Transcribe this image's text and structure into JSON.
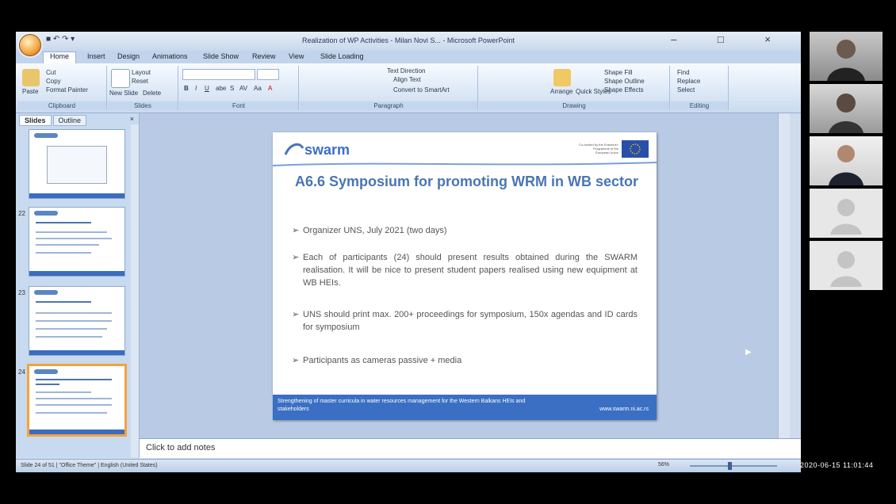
{
  "window": {
    "title": "Realization of WP Activities - Milan Novi S... - Microsoft PowerPoint",
    "quick_access": "■ ↶ ↷ ▾",
    "controls": "– □ ×"
  },
  "ribbon": {
    "tabs": [
      "Home",
      "Insert",
      "Design",
      "Animations",
      "Slide Show",
      "Review",
      "View",
      "Slide Loading"
    ],
    "active_tab": "Home",
    "groups": [
      {
        "label": "Clipboard",
        "buttons": [
          "Cut",
          "Copy",
          "Paste",
          "Format Painter"
        ]
      },
      {
        "label": "Slides",
        "buttons": [
          "Layout",
          "Reset",
          "New Slide",
          "Delete"
        ]
      },
      {
        "label": "Font",
        "buttons": [
          "B",
          "I",
          "U",
          "abe",
          "S",
          "AV",
          "Aa",
          "A"
        ]
      },
      {
        "label": "Paragraph",
        "buttons": [
          "Text Direction",
          "Align Text",
          "Convert to SmartArt"
        ]
      },
      {
        "label": "Drawing",
        "buttons": [
          "Arrange",
          "Quick Styles",
          "Shape Fill",
          "Shape Outline",
          "Shape Effects"
        ]
      },
      {
        "label": "Editing",
        "buttons": [
          "Find",
          "Replace",
          "Select"
        ]
      }
    ]
  },
  "slides_pane": {
    "tabs": [
      "Slides",
      "Outline"
    ],
    "close": "×",
    "thumbnails": [
      {
        "number": "",
        "title": "Certificate"
      },
      {
        "number": "22",
        "title": "A6.4 Training of trainers"
      },
      {
        "number": "23",
        "title": "A6.5 Dissemination"
      },
      {
        "number": "24",
        "title": "A6.6 Symposium for promoting WRM in WB sector"
      }
    ]
  },
  "slide": {
    "logo_text": "swarm",
    "eu_text": "Co-funded by the Erasmus+ Programme of the European Union",
    "title": "A6.6 Symposium for promoting WRM in WB sector",
    "bullets": [
      "Organizer UNS, July 2021 (two days)",
      "Each of participants (24) should present results obtained during the SWARM realisation. It will be nice to present student papers realised using new equipment at WB HEIs.",
      "UNS should print max. 200+ proceedings for symposium, 150x agendas and ID cards for symposium",
      "Participants as cameras passive + media"
    ],
    "bullet_mark": "➢",
    "footer_left": "Strengthening of master curricula in water resources management for the Western Balkans HEIs and stakeholders",
    "footer_right": "www.swarm.ni.ac.rs"
  },
  "notes": {
    "placeholder": "Click to add notes"
  },
  "status": {
    "text": "Slide 24 of 51  |  \"Office Theme\"  |  English (United States)",
    "zoom": "56%"
  },
  "overlay": {
    "timestamp": "2020-06-15 11:01:44"
  },
  "colors": {
    "title_blue": "#4a75b3",
    "footer_blue": "#3a6fc3",
    "selection": "#f6a23a"
  }
}
